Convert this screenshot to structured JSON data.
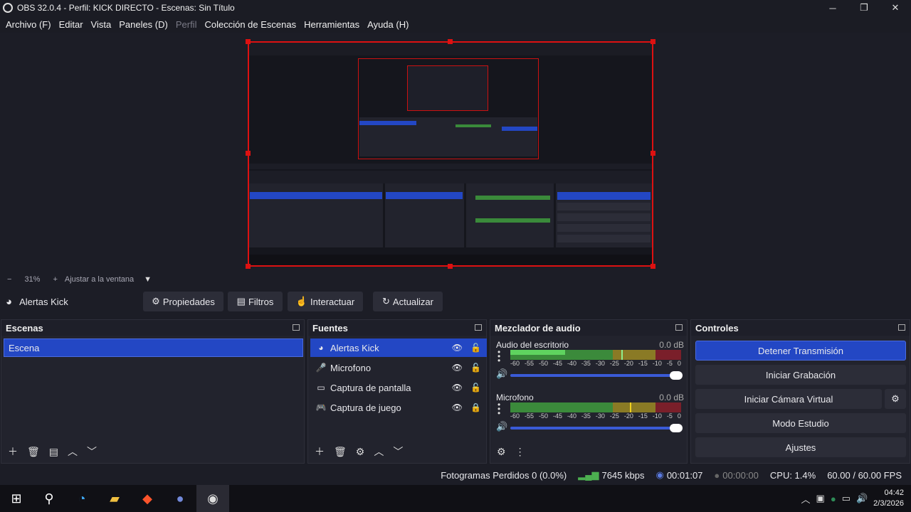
{
  "window": {
    "title": "OBS 32.0.4 - Perfil: KICK DIRECTO - Escenas: Sin Título"
  },
  "menu": [
    "Archivo (F)",
    "Editar",
    "Vista",
    "Paneles (D)",
    "Perfil",
    "Colección de Escenas",
    "Herramientas",
    "Ayuda (H)"
  ],
  "zoom": {
    "minus": "−",
    "value": "31%",
    "plus": "+",
    "fit": "Ajustar a la ventana"
  },
  "source_toolbar": {
    "name": "Alertas Kick",
    "properties": "Propiedades",
    "filters": "Filtros",
    "interact": "Interactuar",
    "refresh": "Actualizar"
  },
  "scenes": {
    "title": "Escenas",
    "items": [
      "Escena"
    ]
  },
  "sources": {
    "title": "Fuentes",
    "items": [
      {
        "label": "Alertas Kick",
        "icon": "browser-icon"
      },
      {
        "label": "Microfono",
        "icon": "microphone-icon"
      },
      {
        "label": "Captura de pantalla",
        "icon": "monitor-icon"
      },
      {
        "label": "Captura de juego",
        "icon": "gamepad-icon"
      }
    ]
  },
  "mixer": {
    "title": "Mezclador de audio",
    "ticks": [
      "-60",
      "-55",
      "-50",
      "-45",
      "-40",
      "-35",
      "-30",
      "-25",
      "-20",
      "-15",
      "-10",
      "-5",
      "0"
    ],
    "channels": [
      {
        "name": "Audio del escritorio",
        "db": "0.0 dB",
        "level": 0.32,
        "peak": 0.65
      },
      {
        "name": "Microfono",
        "db": "0.0 dB",
        "level": 0.35,
        "peak": 0.7
      }
    ]
  },
  "controls": {
    "title": "Controles",
    "stop_stream": "Detener Transmisión",
    "start_recording": "Iniciar Grabación",
    "virtual_cam": "Iniciar Cámara Virtual",
    "studio_mode": "Modo Estudio",
    "settings": "Ajustes"
  },
  "status": {
    "dropped": "Fotogramas Perdidos 0 (0.0%)",
    "bitrate": "7645 kbps",
    "stream_time": "00:01:07",
    "rec_time": "00:00:00",
    "cpu": "CPU: 1.4%",
    "fps": "60.00 / 60.00 FPS"
  },
  "taskbar": {
    "time": "04:42",
    "date": "2/3/2026"
  },
  "colors": {
    "accent": "#2347c4",
    "selection": "#dd1111",
    "meter_green": "#4caf50"
  }
}
